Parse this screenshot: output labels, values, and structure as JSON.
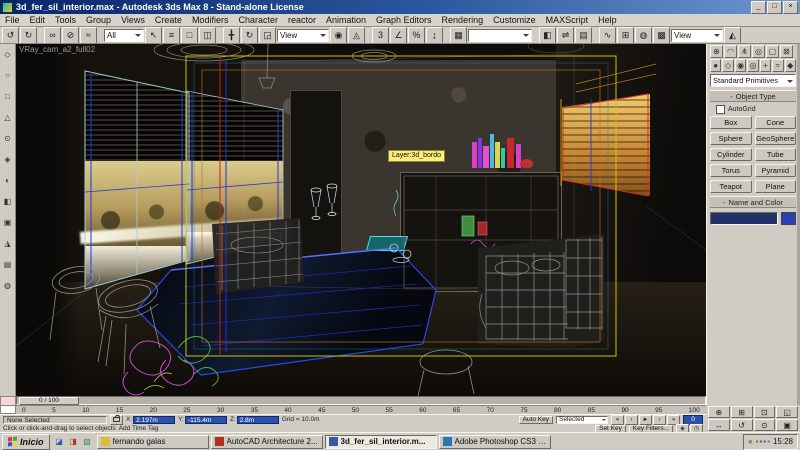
{
  "window": {
    "title": "3d_fer_sil_interior.max - Autodesk 3ds Max 8 - Stand-alone License",
    "controls": {
      "minimize": "_",
      "maximize": "□",
      "close": "×"
    }
  },
  "menu": {
    "items": [
      "File",
      "Edit",
      "Tools",
      "Group",
      "Views",
      "Create",
      "Modifiers",
      "Character",
      "reactor",
      "Animation",
      "Graph Editors",
      "Rendering",
      "Customize",
      "MAXScript",
      "Help"
    ]
  },
  "toolbar": {
    "items": [
      {
        "name": "undo-icon",
        "glyph": "↺",
        "cls": "btn"
      },
      {
        "name": "redo-icon",
        "glyph": "↻",
        "cls": "btn"
      },
      {
        "name": "toolbar-separator",
        "cls": "sep"
      },
      {
        "name": "select-and-link-icon",
        "glyph": "∞",
        "cls": "btn"
      },
      {
        "name": "unlink-selection-icon",
        "glyph": "⊘",
        "cls": "btn"
      },
      {
        "name": "bind-to-spacewarp-icon",
        "glyph": "≈",
        "cls": "btn"
      },
      {
        "name": "toolbar-separator",
        "cls": "sep"
      },
      {
        "name": "selection-filter-combo",
        "label": "All",
        "cls": "combo w40"
      },
      {
        "name": "select-object-icon",
        "glyph": "↖",
        "cls": "btn"
      },
      {
        "name": "select-by-name-icon",
        "glyph": "≡",
        "cls": "btn"
      },
      {
        "name": "rectangular-selection-icon",
        "glyph": "□",
        "cls": "btn"
      },
      {
        "name": "window-crossing-icon",
        "glyph": "◫",
        "cls": "btn"
      },
      {
        "name": "toolbar-separator",
        "cls": "sep"
      },
      {
        "name": "select-and-move-icon",
        "glyph": "╋",
        "cls": "btn"
      },
      {
        "name": "select-and-rotate-icon",
        "glyph": "↻",
        "cls": "btn"
      },
      {
        "name": "select-and-scale-icon",
        "glyph": "◲",
        "cls": "btn"
      },
      {
        "name": "reference-coordinate-combo",
        "label": "View",
        "cls": "combo w52"
      },
      {
        "name": "use-pivot-center-icon",
        "glyph": "◉",
        "cls": "btn"
      },
      {
        "name": "select-and-manipulate-icon",
        "glyph": "◬",
        "cls": "btn"
      },
      {
        "name": "toolbar-separator",
        "cls": "sep"
      },
      {
        "name": "snap-toggle-icon",
        "glyph": "3",
        "cls": "btn"
      },
      {
        "name": "angle-snap-icon",
        "glyph": "∠",
        "cls": "btn"
      },
      {
        "name": "percent-snap-icon",
        "glyph": "%",
        "cls": "btn"
      },
      {
        "name": "spinner-snap-icon",
        "glyph": "↨",
        "cls": "btn"
      },
      {
        "name": "toolbar-separator",
        "cls": "sep"
      },
      {
        "name": "named-selection-sets-icon",
        "glyph": "▦",
        "cls": "btn"
      },
      {
        "name": "named-sets-combo",
        "label": "",
        "cls": "combo w64"
      },
      {
        "name": "toolbar-separator",
        "cls": "sep"
      },
      {
        "name": "mirror-icon",
        "glyph": "◧",
        "cls": "btn"
      },
      {
        "name": "align-icon",
        "glyph": "⇌",
        "cls": "btn"
      },
      {
        "name": "layer-manager-icon",
        "glyph": "▤",
        "cls": "btn"
      },
      {
        "name": "toolbar-separator",
        "cls": "sep"
      },
      {
        "name": "curve-editor-icon",
        "glyph": "∿",
        "cls": "btn"
      },
      {
        "name": "schematic-view-icon",
        "glyph": "⊞",
        "cls": "btn"
      },
      {
        "name": "material-editor-icon",
        "glyph": "◍",
        "cls": "btn"
      },
      {
        "name": "render-scene-icon",
        "glyph": "▩",
        "cls": "btn"
      },
      {
        "name": "render-type-combo",
        "label": "View",
        "cls": "combo w52"
      },
      {
        "name": "quick-render-icon",
        "glyph": "◭",
        "cls": "btn"
      }
    ]
  },
  "left_toolbar": {
    "items": [
      {
        "name": "left-toolbar-button-1",
        "glyph": "◇"
      },
      {
        "name": "left-toolbar-button-2",
        "glyph": "○"
      },
      {
        "name": "left-toolbar-button-3",
        "glyph": "□"
      },
      {
        "name": "left-toolbar-button-4",
        "glyph": "△"
      },
      {
        "name": "left-toolbar-button-5",
        "glyph": "⊙"
      },
      {
        "name": "left-toolbar-button-6",
        "glyph": "◈"
      },
      {
        "name": "left-toolbar-button-7",
        "glyph": "◐"
      },
      {
        "name": "left-toolbar-button-8",
        "glyph": "◧"
      },
      {
        "name": "left-toolbar-button-9",
        "glyph": "▣"
      },
      {
        "name": "left-toolbar-button-10",
        "glyph": "◮"
      },
      {
        "name": "left-toolbar-button-11",
        "glyph": "▤"
      },
      {
        "name": "left-toolbar-button-12",
        "glyph": "◍"
      }
    ]
  },
  "viewport": {
    "camera_label": "VRay_cam_a2_full02",
    "tooltip": "Layer:3d_bordo"
  },
  "command_panel": {
    "tabs": [
      {
        "name": "create-tab",
        "glyph": "⊕"
      },
      {
        "name": "modify-tab",
        "glyph": "◠"
      },
      {
        "name": "hierarchy-tab",
        "glyph": "⋔"
      },
      {
        "name": "motion-tab",
        "glyph": "◎"
      },
      {
        "name": "display-tab",
        "glyph": "▢"
      },
      {
        "name": "utilities-tab",
        "glyph": "⊠"
      }
    ],
    "categories": [
      {
        "name": "geometry-category-icon",
        "glyph": "●"
      },
      {
        "name": "shapes-category-icon",
        "glyph": "◇"
      },
      {
        "name": "lights-category-icon",
        "glyph": "◉"
      },
      {
        "name": "cameras-category-icon",
        "glyph": "◎"
      },
      {
        "name": "helpers-category-icon",
        "glyph": "+"
      },
      {
        "name": "spacewarps-category-icon",
        "glyph": "≈"
      },
      {
        "name": "systems-category-icon",
        "glyph": "◆"
      }
    ],
    "dropdown_value": "Standard Primitives",
    "collapse_glyph": "-",
    "rollout_object_type": "Object Type",
    "autogrid_label": "AutoGrid",
    "object_buttons": [
      "Box",
      "Cone",
      "Sphere",
      "GeoSphere",
      "Cylinder",
      "Tube",
      "Torus",
      "Pyramid",
      "Teapot",
      "Plane"
    ],
    "rollout_name_color": "Name and Color"
  },
  "timeline": {
    "slider_label": "0 / 100",
    "ticks": [
      "0",
      "5",
      "10",
      "15",
      "20",
      "25",
      "30",
      "35",
      "40",
      "45",
      "50",
      "55",
      "60",
      "65",
      "70",
      "75",
      "80",
      "85",
      "90",
      "95",
      "100"
    ]
  },
  "status_bar": {
    "selection_status": "None Selected",
    "prompt": "Click or click-and-drag to select objects",
    "add_time_tag": "Add Time Tag",
    "x_label": "X:",
    "y_label": "Y:",
    "z_label": "Z:",
    "x_value": "2.197m",
    "y_value": "-115.4m",
    "z_value": "2.8m",
    "grid_label": "Grid = 10.0m",
    "auto_key": "Auto Key",
    "set_key": "Set Key",
    "selected_combo": "Selected",
    "key_filters": "Key Filters...",
    "frame_field": "0",
    "playback": [
      {
        "name": "go-to-start-icon",
        "glyph": "«"
      },
      {
        "name": "previous-frame-icon",
        "glyph": "‹"
      },
      {
        "name": "play-icon",
        "glyph": "►"
      },
      {
        "name": "next-frame-icon",
        "glyph": "›"
      },
      {
        "name": "go-to-end-icon",
        "glyph": "»"
      }
    ],
    "extra_icons": [
      {
        "name": "key-mode-icon",
        "glyph": "◈"
      },
      {
        "name": "time-configuration-icon",
        "glyph": "◷"
      }
    ]
  },
  "nav_cluster": {
    "items": [
      {
        "name": "zoom-icon",
        "glyph": "⊕"
      },
      {
        "name": "zoom-all-icon",
        "glyph": "⊞"
      },
      {
        "name": "zoom-extents-icon",
        "glyph": "⊡"
      },
      {
        "name": "zoom-region-icon",
        "glyph": "◱"
      },
      {
        "name": "pan-icon",
        "glyph": "↔"
      },
      {
        "name": "arc-rotate-icon",
        "glyph": "↺"
      },
      {
        "name": "field-of-view-icon",
        "glyph": "⊙"
      },
      {
        "name": "maximize-viewport-icon",
        "glyph": "▣"
      }
    ]
  },
  "taskbar": {
    "start_label": "Inicio",
    "quick_launch": [
      {
        "name": "quick-launch-icon-1",
        "glyph": "◪",
        "cls": "q1"
      },
      {
        "name": "quick-launch-icon-2",
        "glyph": "◨",
        "cls": "q2"
      },
      {
        "name": "quick-launch-icon-3",
        "glyph": "▨",
        "cls": "q3"
      }
    ],
    "tasks": [
      {
        "name": "taskbar-item",
        "label": "fernando galas",
        "cls": "",
        "ico": "ico-folder"
      },
      {
        "name": "taskbar-item",
        "label": "AutoCAD Architecture 2...",
        "cls": "",
        "ico": "ico-acad"
      },
      {
        "name": "taskbar-item",
        "label": "3d_fer_sil_interior.m...",
        "cls": "active",
        "ico": "ico-max"
      },
      {
        "name": "taskbar-item",
        "label": "Adobe Photoshop CS3 E...",
        "cls": "",
        "ico": "ico-ps"
      }
    ],
    "tray_chevron": "«",
    "tray_icons": [
      {
        "name": "tray-icon-1",
        "glyph": "▪",
        "cls": "t1"
      },
      {
        "name": "tray-icon-2",
        "glyph": "▪",
        "cls": "t2"
      },
      {
        "name": "tray-icon-3",
        "glyph": "▪",
        "cls": "t3"
      },
      {
        "name": "tray-icon-4",
        "glyph": "▪",
        "cls": "t4"
      }
    ],
    "time": "15:28"
  }
}
